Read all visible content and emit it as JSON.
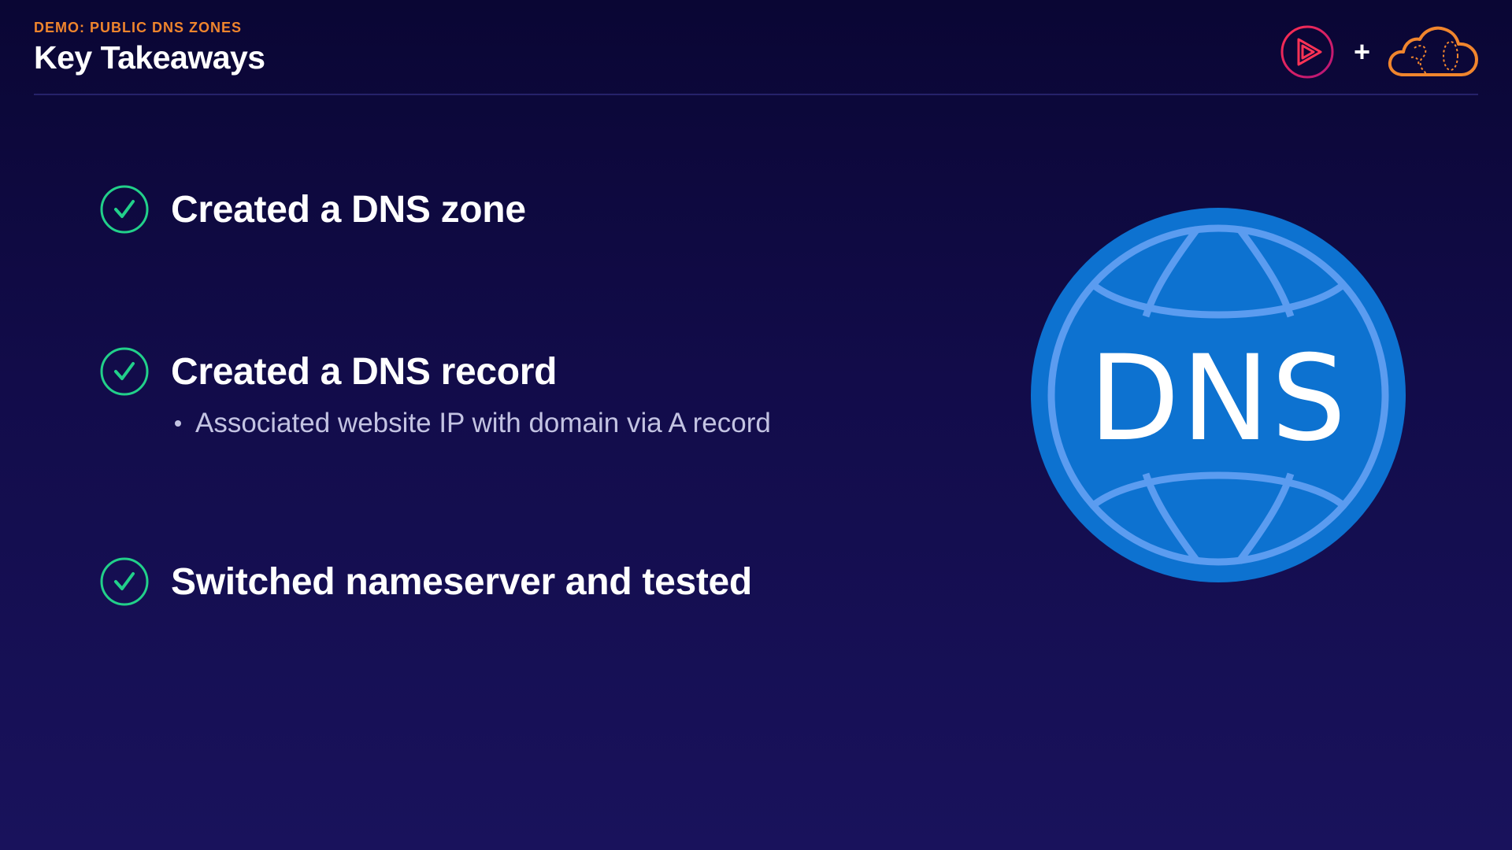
{
  "header": {
    "eyebrow": "DEMO: PUBLIC DNS ZONES",
    "title": "Key Takeaways"
  },
  "logos": {
    "left_icon": "play-circle-icon",
    "plus": "+",
    "right_icon": "cloud-icon"
  },
  "takeaways": [
    {
      "label": "Created a DNS zone",
      "icon": "check-circle-icon"
    },
    {
      "label": "Created a DNS record",
      "icon": "check-circle-icon",
      "sub": "Associated website IP with domain via A record"
    },
    {
      "label": "Switched nameserver and tested",
      "icon": "check-circle-icon"
    }
  ],
  "illustration": {
    "text": "DNS",
    "icon": "dns-globe-icon"
  },
  "colors": {
    "accent_orange": "#f0852d",
    "check_green": "#22d08a",
    "globe_blue": "#0d72d0",
    "globe_lines": "#5b9cf0",
    "play_red": "#e0294a"
  }
}
